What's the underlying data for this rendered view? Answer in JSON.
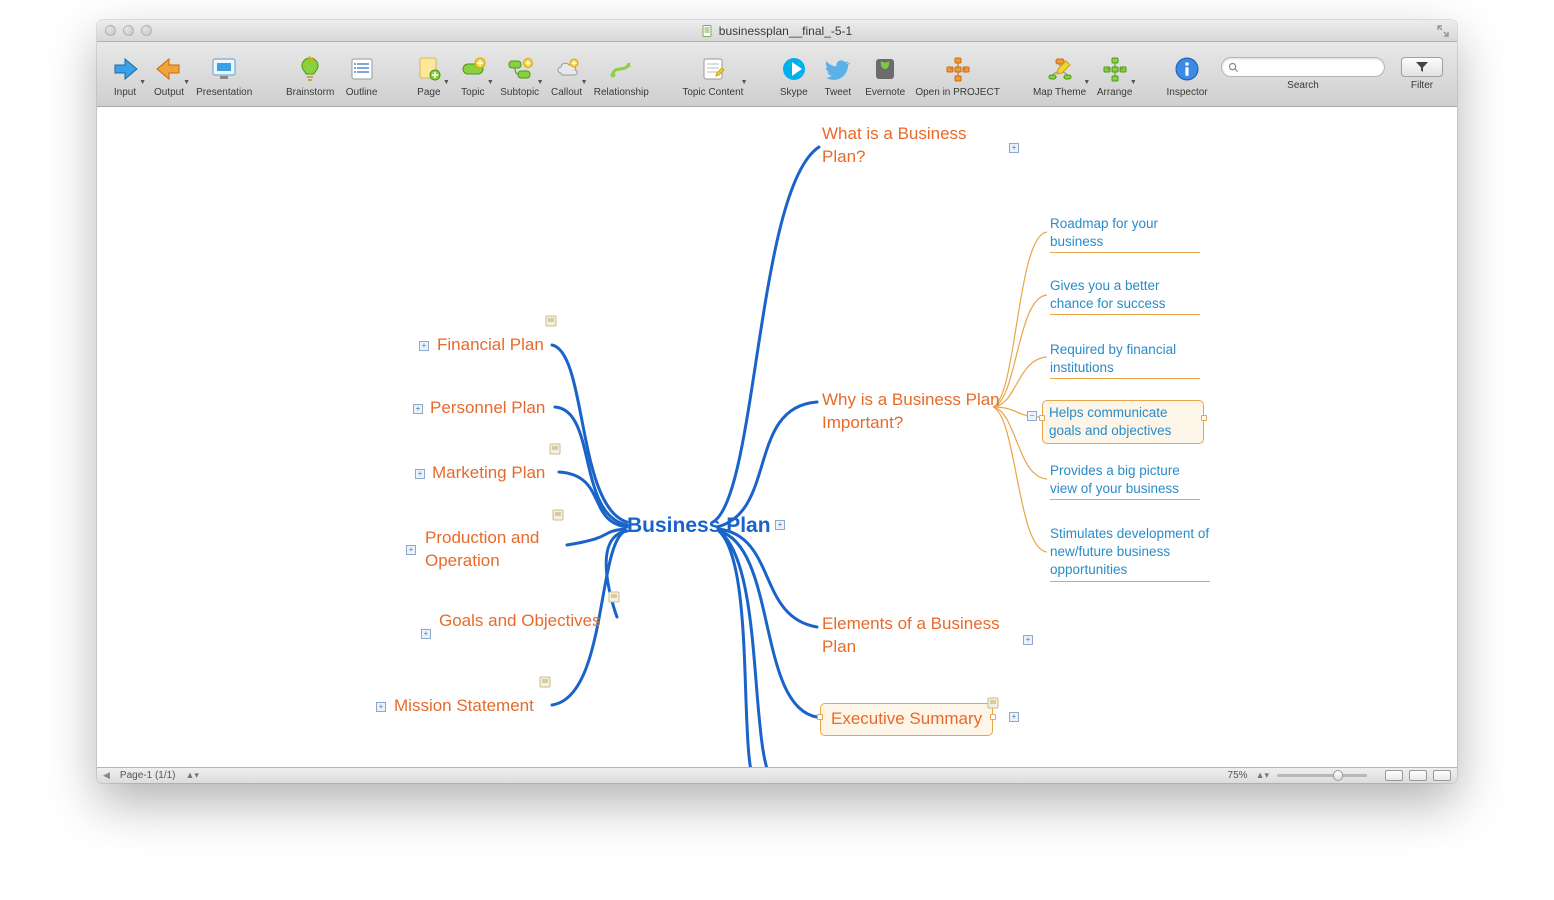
{
  "window": {
    "title": "businessplan__final_-5-1"
  },
  "toolbar": {
    "items": [
      {
        "label": "Input",
        "icon": "arrow-in-blue",
        "dd": true
      },
      {
        "label": "Output",
        "icon": "arrow-out-orange",
        "dd": true
      },
      {
        "label": "Presentation",
        "icon": "screen",
        "dd": false
      },
      {
        "sep": true
      },
      {
        "label": "Brainstorm",
        "icon": "lightbulb-green",
        "dd": false
      },
      {
        "label": "Outline",
        "icon": "list",
        "dd": false
      },
      {
        "sep": true
      },
      {
        "label": "Page",
        "icon": "page-add",
        "dd": true
      },
      {
        "label": "Topic",
        "icon": "topic-green",
        "dd": true
      },
      {
        "label": "Subtopic",
        "icon": "subtopic-green",
        "dd": true
      },
      {
        "label": "Callout",
        "icon": "cloud",
        "dd": true
      },
      {
        "label": "Relationship",
        "icon": "arrows-green",
        "dd": false
      },
      {
        "sep": true
      },
      {
        "label": "Topic Content",
        "icon": "notepad",
        "dd": true
      },
      {
        "sep": true
      },
      {
        "label": "Skype",
        "icon": "skype",
        "dd": false
      },
      {
        "label": "Tweet",
        "icon": "tweet",
        "dd": false
      },
      {
        "label": "Evernote",
        "icon": "evernote",
        "dd": false
      },
      {
        "label": "Open in PROJECT",
        "icon": "arrange-orange",
        "dd": false
      },
      {
        "sep": true
      },
      {
        "label": "Map Theme",
        "icon": "theme",
        "dd": true
      },
      {
        "label": "Arrange",
        "icon": "arrange-green",
        "dd": true
      },
      {
        "sep": true
      },
      {
        "label": "Inspector",
        "icon": "info",
        "dd": false
      }
    ],
    "search_label": "Search",
    "filter_label": "Filter"
  },
  "mindmap": {
    "center": "Business Plan",
    "right": [
      {
        "text": "What is a Business Plan?"
      },
      {
        "text": "Why is a Business Plan Important?",
        "children": [
          "Roadmap for your business",
          "Gives you a better chance for success",
          "Required by financial institutions",
          "Helps communicate goals and objectives",
          "Provides a big picture view of your business",
          "Stimulates development of new/future business opportunities"
        ],
        "selected_child_index": 3
      },
      {
        "text": "Elements of a Business Plan"
      },
      {
        "text": "Executive Summary",
        "selected": true
      }
    ],
    "left": [
      {
        "text": "Financial Plan"
      },
      {
        "text": "Personnel Plan"
      },
      {
        "text": "Marketing Plan"
      },
      {
        "text": "Production and Operation"
      },
      {
        "text": "Goals and Objectives"
      },
      {
        "text": "Mission Statement"
      }
    ]
  },
  "statusbar": {
    "page": "Page-1 (1/1)",
    "zoom": "75%"
  }
}
